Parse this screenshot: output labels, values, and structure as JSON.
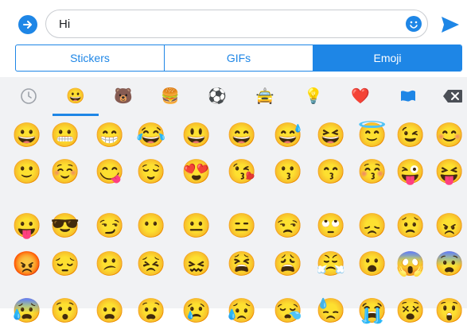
{
  "compose": {
    "message_text": "Hi"
  },
  "tabs": [
    "Stickers",
    "GIFs",
    "Emoji"
  ],
  "active_tab": "Emoji",
  "categories": [
    {
      "name": "recent",
      "glyph": "🕒"
    },
    {
      "name": "smileys",
      "glyph": "😀"
    },
    {
      "name": "animals",
      "glyph": "🐻"
    },
    {
      "name": "food",
      "glyph": "🍔"
    },
    {
      "name": "activity",
      "glyph": "⚽"
    },
    {
      "name": "travel",
      "glyph": "🚖"
    },
    {
      "name": "objects",
      "glyph": "💡"
    },
    {
      "name": "symbols",
      "glyph": "❤️"
    },
    {
      "name": "flags",
      "glyph": "🏳"
    }
  ],
  "emoji_rows": [
    [
      "😀",
      "😬",
      "😁",
      "😂",
      "😃",
      "😄",
      "😅",
      "😆",
      "😇",
      "😉",
      "😊"
    ],
    [
      "🙂",
      "☺️",
      "😋",
      "😌",
      "😍",
      "😘",
      "😗",
      "😙",
      "😚",
      "😜",
      "😝"
    ],
    [
      "😛",
      "😎",
      "😏",
      "😶",
      "😐",
      "😑",
      "😒",
      "🙄",
      "😞",
      "😟",
      "😠"
    ],
    [
      "😡",
      "😔",
      "😕",
      "😣",
      "😖",
      "😫",
      "😩",
      "😤",
      "😮",
      "😱",
      "😨"
    ],
    [
      "😰",
      "😯",
      "😦",
      "😧",
      "😢",
      "😥",
      "😪",
      "😓",
      "😭",
      "😵",
      "😲"
    ]
  ],
  "colors": {
    "accent": "#1e86e6",
    "background": "#f1f2f4"
  }
}
